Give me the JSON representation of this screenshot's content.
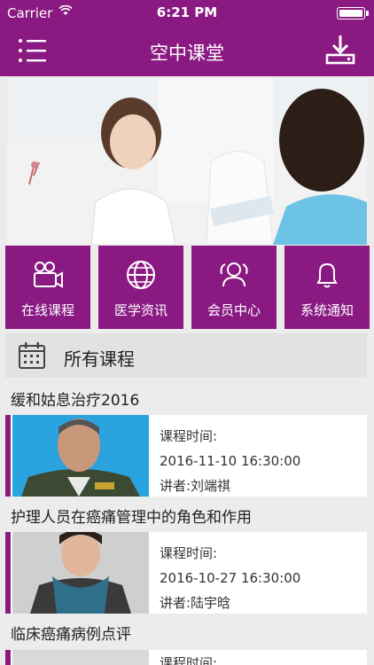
{
  "statusbar": {
    "carrier": "Carrier",
    "time": "6:21 PM"
  },
  "navbar": {
    "title": "空中课堂"
  },
  "tiles": [
    {
      "label": "在线课程",
      "icon": "video-camera-icon"
    },
    {
      "label": "医学资讯",
      "icon": "globe-icon"
    },
    {
      "label": "会员中心",
      "icon": "users-icon"
    },
    {
      "label": "系统通知",
      "icon": "bell-icon"
    }
  ],
  "section": {
    "label": "所有课程",
    "icon": "calendar-icon"
  },
  "courses": [
    {
      "title": "缓和姑息治疗2016",
      "time_label": "课程时间:",
      "time": "2016-11-10 16:30:00",
      "lecturer": "讲者:刘端祺"
    },
    {
      "title": "护理人员在癌痛管理中的角色和作用",
      "time_label": "课程时间:",
      "time": "2016-10-27 16:30:00",
      "lecturer": "讲者:陆宇晗"
    },
    {
      "title": "临床癌痛病例点评",
      "time_label": "课程时间:"
    }
  ],
  "colors": {
    "primary": "#8a1a82",
    "background": "#ececec"
  }
}
